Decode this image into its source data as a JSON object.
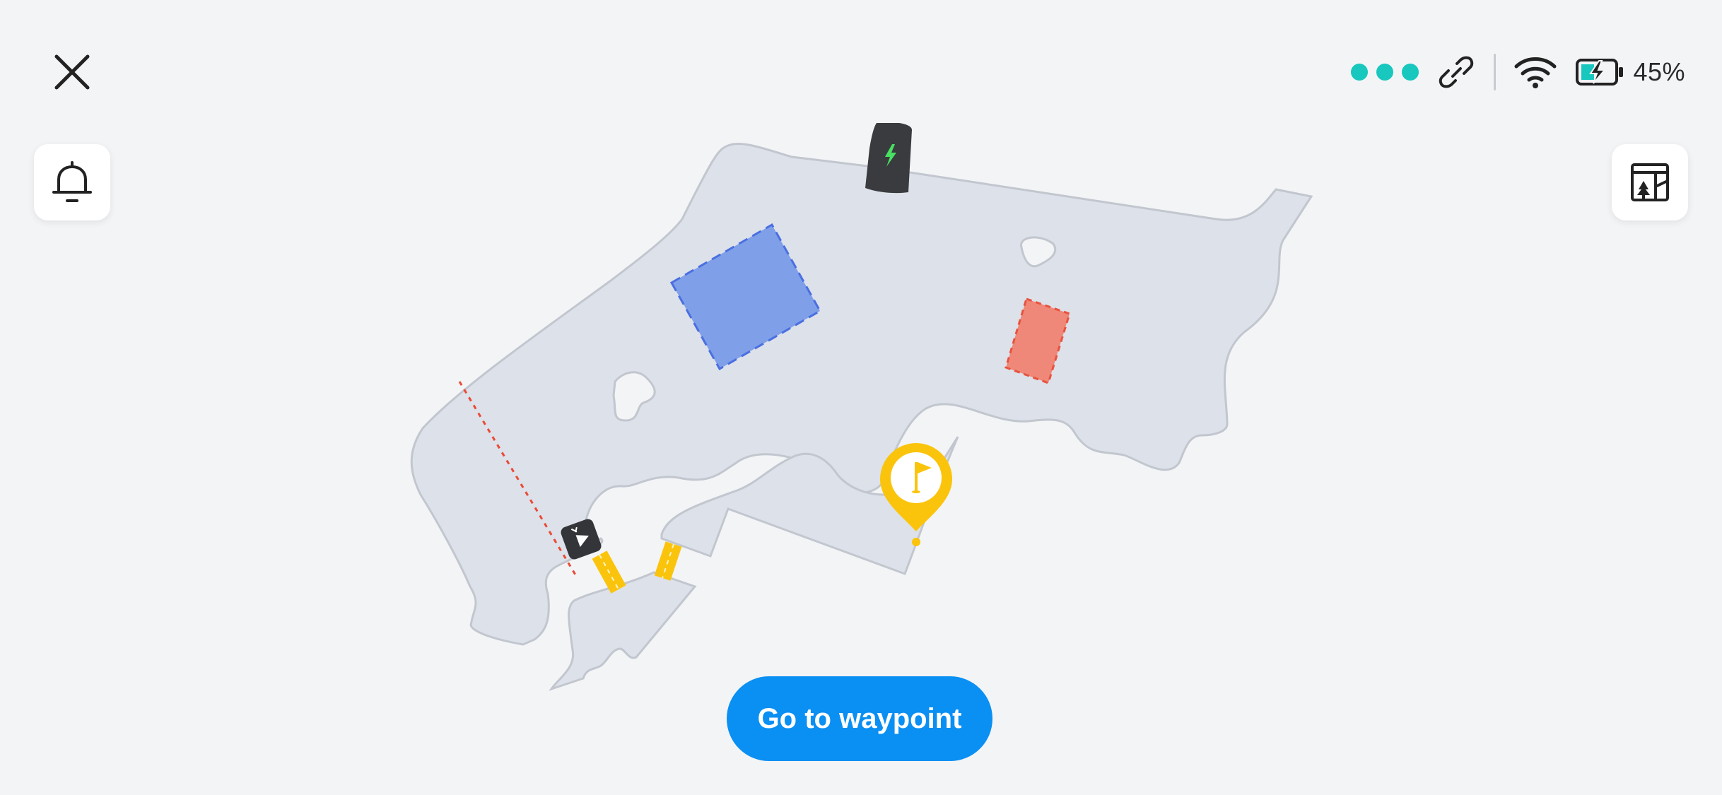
{
  "status": {
    "connection_dots": 3,
    "battery_percent": "45%",
    "colors": {
      "accent": "#18c7bd",
      "battery_fill": "#18c7bd"
    }
  },
  "icons": {
    "close": "close-icon",
    "bell": "bell-icon",
    "map_layers": "map-layers-icon",
    "link": "link-icon",
    "wifi": "wifi-icon",
    "battery": "battery-charging-icon",
    "station": "charging-station-icon",
    "mower": "mower-icon",
    "waypoint": "waypoint-flag-icon"
  },
  "map": {
    "colors": {
      "lawn_fill": "#dde1e9",
      "lawn_stroke": "#c2c6ce",
      "zone_blue": "#7f9fe9",
      "zone_red": "#ef8878",
      "boundary_line": "#ea4a36",
      "path": "#fbc40c",
      "waypoint": "#fbc40c"
    }
  },
  "action": {
    "label": "Go to waypoint",
    "color": "#0a8ff3"
  }
}
